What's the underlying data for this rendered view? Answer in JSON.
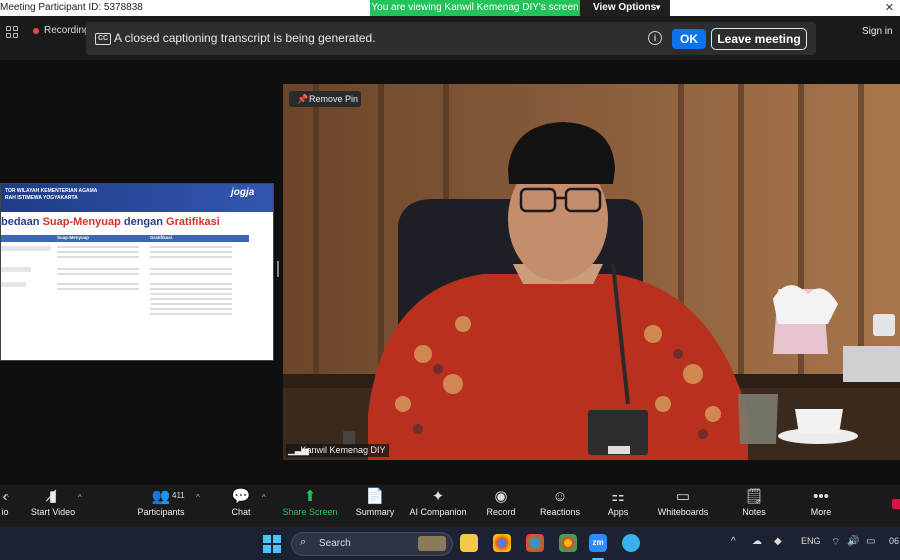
{
  "window": {
    "title": "Meeting Participant ID: 5378838",
    "viewing_banner": "You are viewing Kanwil Kemenag DIY's screen",
    "view_options_label": "View Options"
  },
  "topbar": {
    "recording_label": "Recording",
    "caption_message": "A closed captioning transcript is being generated.",
    "cc_badge": "CC",
    "ok_label": "OK",
    "leave_label": "Leave meeting",
    "sign_in_label": "Sign in"
  },
  "shared_slide": {
    "org_line_1": "TOR WILAYAH KEMENTERIAN AGAMA",
    "org_line_2": "RAH ISTIMEWA YOGYAKARTA",
    "logo": "jogja",
    "title_start": "bedaan ",
    "title_red_1": "Suap-Menyuap",
    "title_middle": " dengan ",
    "title_red_2": "Gratifikasi",
    "col_1": "Suap-Menyuap",
    "col_2": "Gratifikasi"
  },
  "video": {
    "remove_pin_label": "Remove Pin",
    "participant_name": "Kanwil Kemenag DIY"
  },
  "toolbar": {
    "audio_label": "io",
    "video_label": "Start Video",
    "participants_label": "Participants",
    "participants_count": "411",
    "chat_label": "Chat",
    "share_label": "Share Screen",
    "summary_label": "Summary",
    "ai_label": "AI Companion",
    "record_label": "Record",
    "reactions_label": "Reactions",
    "apps_label": "Apps",
    "whiteboards_label": "Whiteboards",
    "notes_label": "Notes",
    "more_label": "More"
  },
  "taskbar": {
    "search_label": "Search",
    "language": "ENG",
    "clock_fragment": "06"
  },
  "colors": {
    "accent_green": "#23c35b",
    "ok_blue": "#0e72ed",
    "record_red": "#e54b4b"
  }
}
